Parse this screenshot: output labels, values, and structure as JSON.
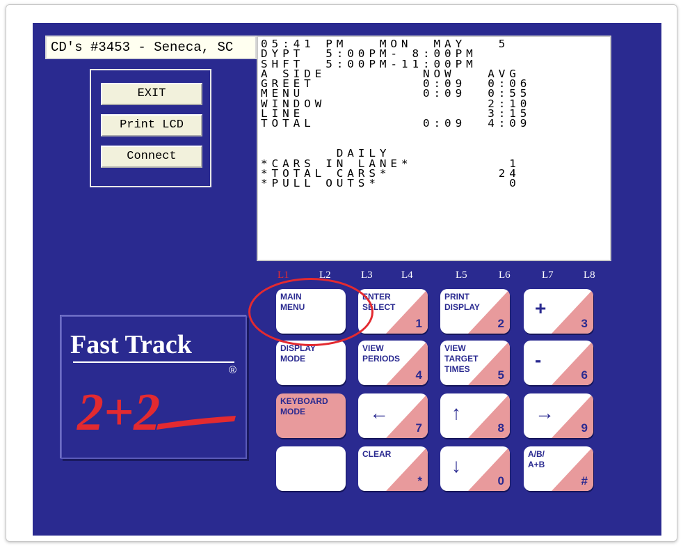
{
  "store_field": "CD's #3453 - Seneca, SC",
  "commands": [
    "EXIT",
    "Print LCD",
    "Connect"
  ],
  "lcd_rows": [
    "05:41 PM   MON  MAY   5",
    "DYPT  5:00PM- 8:00PM",
    "SHFT  5:00PM-11:00PM",
    "A SIDE         NOW   AVG",
    "GREET          0:09  0:06",
    "MENU           0:09  0:55",
    "WINDOW               2:10",
    "LINE                 3:15",
    "TOTAL          0:09  4:09",
    "",
    "",
    "       DAILY",
    "*CARS IN LANE*         1",
    "*TOTAL CARS*          24",
    "*PULL OUTS*            0"
  ],
  "lane_labels": [
    "L1",
    "L2",
    "L3",
    "L4",
    "L5",
    "L6",
    "L7",
    "L8"
  ],
  "lane_label_colors": {
    "L1": "#e32a30",
    "default": "#ffffff"
  },
  "logo": {
    "title": "Fast Track",
    "tagline": "2+2",
    "reg": "®"
  },
  "keys": [
    {
      "label": "MAIN\nMENU",
      "num": "",
      "sym": "",
      "style": "plain"
    },
    {
      "label": "ENTER\nSELECT",
      "num": "1",
      "sym": "",
      "style": "tri"
    },
    {
      "label": "PRINT\nDISPLAY",
      "num": "2",
      "sym": "",
      "style": "tri"
    },
    {
      "label": "",
      "num": "3",
      "sym": "+",
      "style": "tri"
    },
    {
      "label": "DISPLAY\nMODE",
      "num": "",
      "sym": "",
      "style": "plain"
    },
    {
      "label": "VIEW\nPERIODS",
      "num": "4",
      "sym": "",
      "style": "tri"
    },
    {
      "label": "VIEW\nTARGET\nTIMES",
      "num": "5",
      "sym": "",
      "style": "tri"
    },
    {
      "label": "",
      "num": "6",
      "sym": "-",
      "style": "tri"
    },
    {
      "label": "KEYBOARD\nMODE",
      "num": "",
      "sym": "",
      "style": "pink"
    },
    {
      "label": "",
      "num": "7",
      "sym": "←",
      "style": "tri"
    },
    {
      "label": "",
      "num": "8",
      "sym": "↑",
      "style": "tri"
    },
    {
      "label": "",
      "num": "9",
      "sym": "→",
      "style": "tri"
    },
    {
      "label": "",
      "num": "",
      "sym": "",
      "style": "plain"
    },
    {
      "label": "CLEAR",
      "num": "*",
      "sym": "",
      "style": "tri"
    },
    {
      "label": "",
      "num": "0",
      "sym": "↓",
      "style": "tri"
    },
    {
      "label": "A/B/\nA+B",
      "num": "#",
      "sym": "",
      "style": "tri"
    }
  ],
  "colors": {
    "panel": "#2a2a90",
    "accent_pink": "#e89a9c",
    "highlight_red": "#e32a30"
  }
}
